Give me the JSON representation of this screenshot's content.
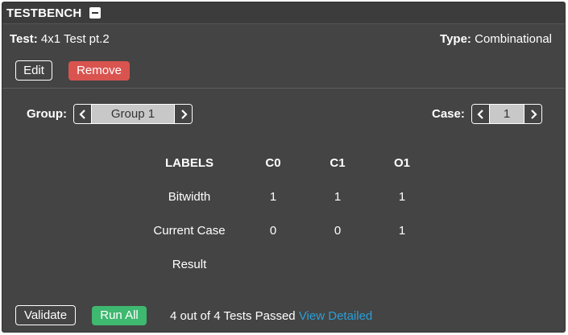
{
  "panel": {
    "title": "TESTBENCH"
  },
  "test": {
    "name_label": "Test:",
    "name_value": "4x1 Test pt.2",
    "type_label": "Type:",
    "type_value": "Combinational"
  },
  "actions": {
    "edit_label": "Edit",
    "remove_label": "Remove"
  },
  "group": {
    "label": "Group:",
    "value": "Group 1"
  },
  "case": {
    "label": "Case:",
    "value": "1"
  },
  "table": {
    "headers": [
      "LABELS",
      "C0",
      "C1",
      "O1"
    ],
    "rows": [
      {
        "label": "Bitwidth",
        "values": [
          "1",
          "1",
          "1"
        ]
      },
      {
        "label": "Current Case",
        "values": [
          "0",
          "0",
          "1"
        ]
      },
      {
        "label": "Result",
        "values": [
          "",
          "",
          ""
        ]
      }
    ]
  },
  "footer": {
    "validate_label": "Validate",
    "runall_label": "Run All",
    "status_text": "4 out of 4 Tests Passed",
    "detail_link": "View Detailed"
  },
  "colors": {
    "panel_bg": "#444444",
    "remove_red": "#d9534f",
    "runall_green": "#3fb870",
    "link_blue": "#2a9fd8",
    "stepper_value_bg": "#c8c8c8"
  }
}
